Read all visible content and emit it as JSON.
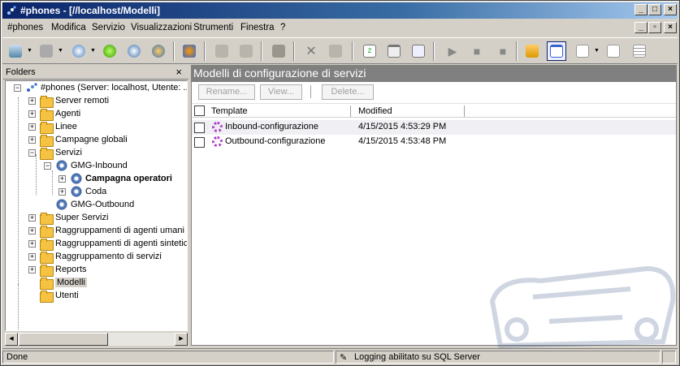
{
  "window": {
    "title": "#phones - [//localhost/Modelli]"
  },
  "menu": [
    {
      "label": "#phones",
      "ul": "#"
    },
    {
      "label": "Modifica",
      "ul": "M"
    },
    {
      "label": "Servizio",
      "ul": "S"
    },
    {
      "label": "Visualizzazioni",
      "ul": "V"
    },
    {
      "label": "Strumenti",
      "ul": "t"
    },
    {
      "label": "Finestra",
      "ul": "F"
    },
    {
      "label": "?",
      "ul": "?"
    }
  ],
  "folders": {
    "title": "Folders",
    "close": "×",
    "root": "#phones (Server: localhost, Utente: ...",
    "items": [
      {
        "label": "Server remoti"
      },
      {
        "label": "Agenti"
      },
      {
        "label": "Linee"
      },
      {
        "label": "Campagne globali"
      },
      {
        "label": "Servizi"
      },
      {
        "label": "GMG-Inbound"
      },
      {
        "label": "Campagna operatori"
      },
      {
        "label": "Coda"
      },
      {
        "label": "GMG-Outbound"
      },
      {
        "label": "Super Servizi"
      },
      {
        "label": "Raggruppamenti di agenti umani"
      },
      {
        "label": "Raggruppamenti di agenti sintetici"
      },
      {
        "label": "Raggruppamento di servizi"
      },
      {
        "label": "Reports"
      },
      {
        "label": "Modelli"
      },
      {
        "label": "Utenti"
      }
    ]
  },
  "panel": {
    "title": "Modelli di configurazione di servizi",
    "actions": {
      "rename": "Rename...",
      "view": "View...",
      "delete": "Delete..."
    },
    "columns": {
      "template": "Template",
      "modified": "Modified"
    },
    "rows": [
      {
        "template": "Inbound-configurazione",
        "modified": "4/15/2015 4:53:29 PM"
      },
      {
        "template": "Outbound-configurazione",
        "modified": "4/15/2015 4:53:48 PM"
      }
    ]
  },
  "status": {
    "left": "Done",
    "middle": "Logging abilitato su SQL Server"
  },
  "colors": {
    "title_start": "#0a246a",
    "title_end": "#a6caf0",
    "panel_header": "#808080",
    "template_icon": "#b040d0"
  }
}
